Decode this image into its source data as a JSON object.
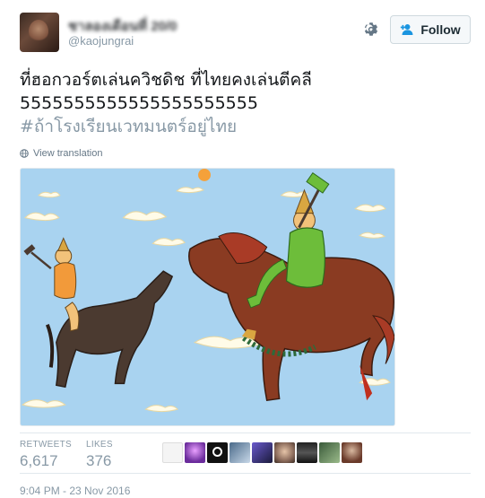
{
  "author": {
    "name": "ชาลองเดือนที่ 20/0",
    "handle": "@kaojungrai"
  },
  "follow_button": {
    "label": "Follow"
  },
  "tweet": {
    "line1": "ที่ฮอกวอร์ตเล่นควิชดิช ที่ไทยคงเล่นตีคลี",
    "line2": "5555555555555555555555",
    "hashtag": "#ถ้าโรงเรียนเวทมนตร์อยู่ไทย"
  },
  "view_translation": "View translation",
  "stats": {
    "retweets_label": "RETWEETS",
    "retweets_value": "6,617",
    "likes_label": "LIKES",
    "likes_value": "376"
  },
  "timestamp": "9:04 PM - 23 Nov 2016",
  "icons": {
    "gear": "gear-icon",
    "follow": "add-user-icon",
    "translate": "globe-icon"
  },
  "colors": {
    "link_gray": "#8899a6",
    "follow_text": "#1c2b33",
    "sky": "#a9d3f0"
  }
}
